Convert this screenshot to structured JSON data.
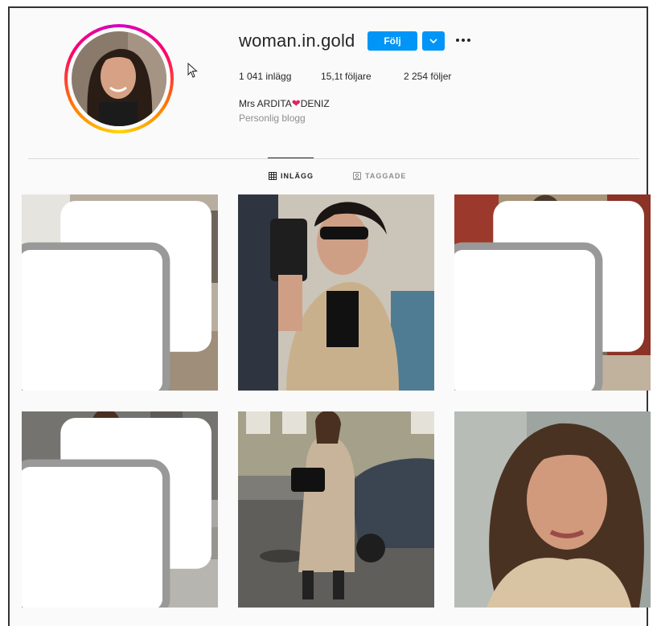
{
  "profile": {
    "username": "woman.in.gold",
    "follow_label": "Följ",
    "posts_stat": "1 041 inlägg",
    "followers_stat": "15,1t följare",
    "following_stat": "2 254 följer",
    "display_name_before": "Mrs ARDITA",
    "display_name_emoji": "❤",
    "display_name_after": "DENIZ",
    "category": "Personlig blogg"
  },
  "tabs": [
    {
      "label": "INLÄGG",
      "icon": "grid-icon",
      "active": true
    },
    {
      "label": "TAGGADE",
      "icon": "tagged-icon",
      "active": false
    }
  ],
  "posts": [
    {
      "icon": "multiple-images-icon"
    },
    {
      "icon": ""
    },
    {
      "icon": "multiple-images-icon"
    },
    {
      "icon": "multiple-images-icon"
    },
    {
      "icon": ""
    },
    {
      "icon": ""
    }
  ],
  "colors": {
    "accent": "#0095f6",
    "text": "#262626",
    "muted": "#8e8e8e",
    "heart": "#e0245e"
  }
}
